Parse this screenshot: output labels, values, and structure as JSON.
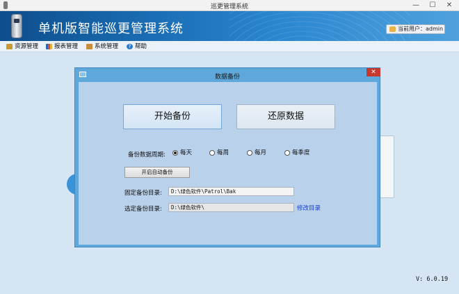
{
  "window": {
    "title": "巡更管理系统",
    "min": "—",
    "max": "☐",
    "close": "✕"
  },
  "banner": {
    "system_title": "单机版智能巡更管理系统",
    "user_label": "当前用户：admin"
  },
  "menu": {
    "items": [
      {
        "label": "资源管理",
        "icon": "folder-icon"
      },
      {
        "label": "报表管理",
        "icon": "report-icon"
      },
      {
        "label": "系统管理",
        "icon": "settings-icon"
      },
      {
        "label": "帮助",
        "icon": "help-icon"
      }
    ]
  },
  "dialog": {
    "title": "数据备份",
    "close": "✕",
    "start_backup": "开始备份",
    "restore_data": "还原数据",
    "period_label": "备份数据周期:",
    "periods": [
      {
        "label": "每天",
        "checked": true
      },
      {
        "label": "每周",
        "checked": false
      },
      {
        "label": "每月",
        "checked": false
      },
      {
        "label": "每季度",
        "checked": false
      }
    ],
    "auto_backup_button": "开启自动备份",
    "fixed_dir_label": "固定备份目录:",
    "fixed_dir_value": "D:\\绿色软件\\Patrol\\Bak",
    "selected_dir_label": "选定备份目录:",
    "selected_dir_value": "D:\\绿色软件\\",
    "change_dir_link": "修改目录"
  },
  "version": "V: 6.0.19"
}
